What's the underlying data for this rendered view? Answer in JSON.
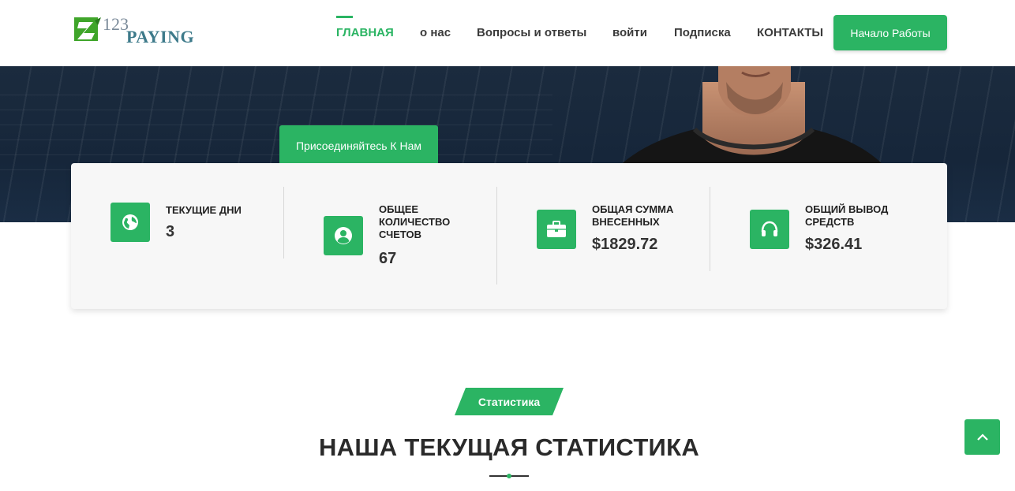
{
  "logo": {
    "brand_number": "123",
    "brand_name": "PAYING"
  },
  "nav": {
    "items": [
      {
        "label": "ГЛАВНАЯ"
      },
      {
        "label": "о нас"
      },
      {
        "label": "Вопросы и ответы"
      },
      {
        "label": "войти"
      },
      {
        "label": "Подписка"
      },
      {
        "label": "КОНТАКТЫ"
      }
    ],
    "cta_label": "Начало Работы"
  },
  "hero": {
    "join_label": "Присоединяйтесь К Нам"
  },
  "stats": [
    {
      "icon": "globe-icon",
      "label": "ТЕКУЩИЕ ДНИ",
      "value": "3"
    },
    {
      "icon": "user-icon",
      "label": "ОБЩЕЕ КОЛИЧЕСТВО СЧЕТОВ",
      "value": "67"
    },
    {
      "icon": "briefcase-icon",
      "label": "ОБЩАЯ СУММА ВНЕСЕННЫХ",
      "value": "$1829.72"
    },
    {
      "icon": "headset-icon",
      "label": "ОБЩИЙ ВЫВОД СРЕДСТВ",
      "value": "$326.41"
    }
  ],
  "section": {
    "badge": "Статистика",
    "title": "НАША ТЕКУЩАЯ СТАТИСТИКА"
  },
  "colors": {
    "accent": "#2bb463",
    "hero_bg": "#1b2b3e"
  }
}
